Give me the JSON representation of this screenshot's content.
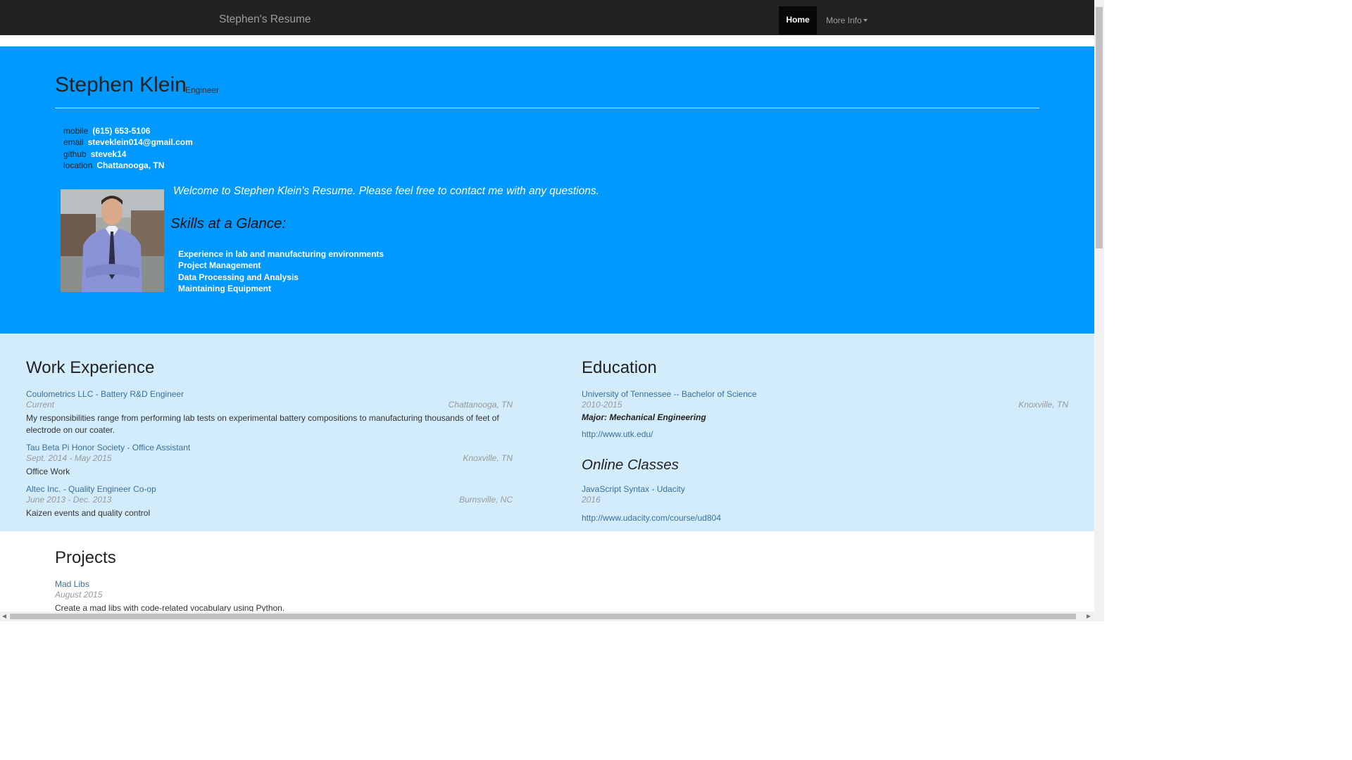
{
  "navbar": {
    "brand": "Stephen's Resume",
    "home": "Home",
    "more_info": "More Info"
  },
  "header": {
    "name": "Stephen Klein",
    "role": "Engineer",
    "contacts": [
      {
        "label": "mobile",
        "value": "(615) 653-5106"
      },
      {
        "label": "email",
        "value": "steveklein014@gmail.com"
      },
      {
        "label": "github",
        "value": "stevek14"
      },
      {
        "label": "location",
        "value": "Chattanooga, TN"
      }
    ],
    "welcome": "Welcome to Stephen Klein's Resume. Please feel free to contact me with any questions.",
    "skills_heading": "Skills at a Glance:",
    "skills": [
      "Experience in lab and manufacturing environments",
      "Project Management",
      "Data Processing and Analysis",
      "Maintaining Equipment"
    ]
  },
  "work": {
    "heading": "Work Experience",
    "jobs": [
      {
        "title": "Coulometrics LLC - Battery R&D Engineer",
        "dates": "Current",
        "location": "Chattanooga, TN",
        "description": "My responsibilities range from performing lab tests on experimental battery compositions to manufacturing thousands of feet of electrode on our coater."
      },
      {
        "title": "Tau Beta Pi Honor Society - Office Assistant",
        "dates": "Sept. 2014 - May 2015",
        "location": "Knoxville, TN",
        "description": "Office Work"
      },
      {
        "title": "Altec Inc. - Quality Engineer Co-op",
        "dates": "June 2013 - Dec. 2013",
        "location": "Burnsville, NC",
        "description": "Kaizen events and quality control"
      }
    ]
  },
  "education": {
    "heading": "Education",
    "school": "University of Tennessee -- Bachelor of Science",
    "dates": "2010-2015",
    "location": "Knoxville, TN",
    "major": "Major: Mechanical Engineering",
    "url": "http://www.utk.edu/",
    "online_heading": "Online Classes",
    "online_title": "JavaScript Syntax - Udacity",
    "online_date": "2016",
    "online_url": "http://www.udacity.com/course/ud804"
  },
  "projects": {
    "heading": "Projects",
    "items": [
      {
        "title": "Mad Libs",
        "date": "August 2015",
        "description": "Create a mad libs with code-related vocabulary using Python."
      }
    ]
  }
}
